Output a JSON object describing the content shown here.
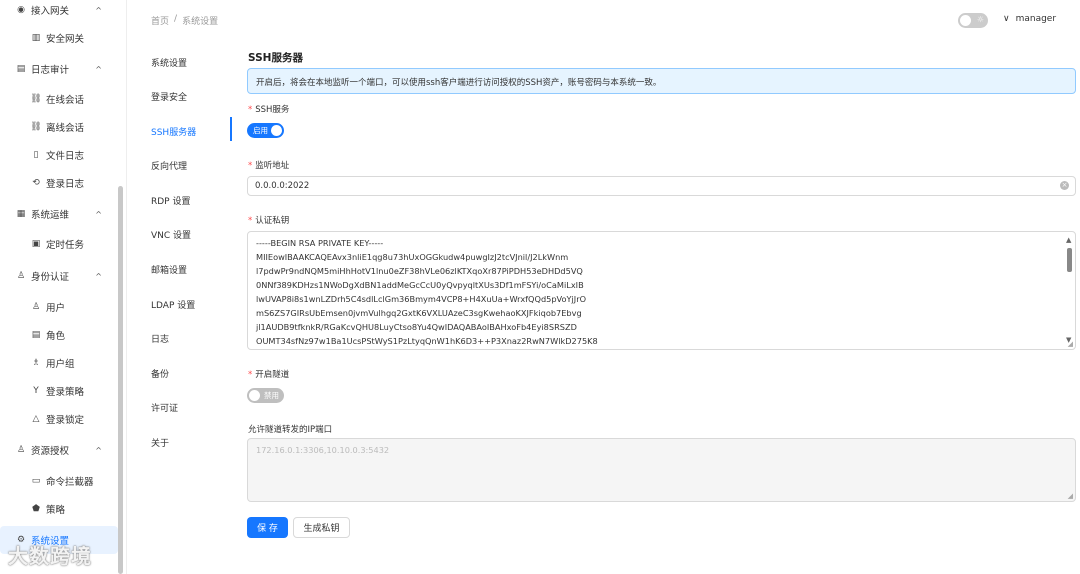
{
  "sidebar": {
    "items": [
      {
        "label": "接入网关",
        "icon": "eye-icon",
        "type": "group",
        "expanded": true
      },
      {
        "label": "安全网关",
        "icon": "gateway-icon",
        "type": "child"
      },
      {
        "label": "日志审计",
        "icon": "log-icon",
        "type": "group",
        "expanded": true
      },
      {
        "label": "在线会话",
        "icon": "link-icon",
        "type": "child"
      },
      {
        "label": "离线会话",
        "icon": "unlink-icon",
        "type": "child"
      },
      {
        "label": "文件日志",
        "icon": "file-icon",
        "type": "child"
      },
      {
        "label": "登录日志",
        "icon": "login-icon",
        "type": "child"
      },
      {
        "label": "系统运维",
        "icon": "grid-icon",
        "type": "group",
        "expanded": true
      },
      {
        "label": "定时任务",
        "icon": "task-icon",
        "type": "child"
      },
      {
        "label": "身份认证",
        "icon": "user-icon",
        "type": "group",
        "expanded": true
      },
      {
        "label": "用户",
        "icon": "user-icon",
        "type": "child"
      },
      {
        "label": "角色",
        "icon": "role-icon",
        "type": "child"
      },
      {
        "label": "用户组",
        "icon": "users-icon",
        "type": "child"
      },
      {
        "label": "登录策略",
        "icon": "strategy-icon",
        "type": "child"
      },
      {
        "label": "登录锁定",
        "icon": "warning-icon",
        "type": "child"
      },
      {
        "label": "资源授权",
        "icon": "user-icon",
        "type": "group",
        "expanded": true
      },
      {
        "label": "命令拦截器",
        "icon": "terminal-icon",
        "type": "child"
      },
      {
        "label": "策略",
        "icon": "shield-icon",
        "type": "child"
      },
      {
        "label": "系统设置",
        "icon": "settings-icon",
        "type": "group",
        "active": true
      }
    ]
  },
  "breadcrumb": {
    "home": "首页",
    "sep": "/",
    "current": "系统设置"
  },
  "header": {
    "user": "manager"
  },
  "settings_nav": {
    "items": [
      "系统设置",
      "登录安全",
      "SSH服务器",
      "反向代理",
      "RDP 设置",
      "VNC 设置",
      "邮箱设置",
      "LDAP 设置",
      "日志",
      "备份",
      "许可证",
      "关于"
    ],
    "active_index": 2
  },
  "form": {
    "title": "SSH服务器",
    "alert": "开启后，将会在本地监听一个端口，可以使用ssh客户端进行访问授权的SSH资产，账号密码与本系统一致。",
    "ssh_service": {
      "label": "SSH服务",
      "state_label": "启用",
      "enabled": true
    },
    "listen_addr": {
      "label": "监听地址",
      "value": "0.0.0.0:2022"
    },
    "private_key": {
      "label": "认证私钥",
      "lines": [
        "-----BEGIN RSA PRIVATE KEY-----",
        "MIIEowIBAAKCAQEAvx3nliE1qg8u73hUxOGGkudw4puwgIzJ2tcVJnil/J2LkWnm",
        "l7pdwPr9ndNQM5miHhHotV1lnu0eZF38hVLe06zlKTXqoXr87PiPDH53eDHDd5VQ",
        "0NNf389KDHzs1NWoDgXdBN1addMeGcCcU0yQvpyqltXUs3Df1mFSYi/oCaMiLxIB",
        "lwUVAP8i8s1wnLZDrh5C4sdlLclGm36Bmym4VCP8+H4XuUa+WrxfQQd5pVoYjJrO",
        "mS6ZS7GIRsUbEmsen0jvmVulhgq2GxtK6VXLUAzeC3sgKwehaoKXJFkiqob7Ebvg",
        "jl1AUDB9tfknkR/RGaKcvQHU8LuyCtso8Yu4QwIDAQABAoIBAHxoFb4Eyi8SRSZD",
        "OUMT34sfNz97w1Ba1UcsPStWyS1PzLtyqQnW1hK6D3++P3Xnaz2RwN7WlkD275K8"
      ]
    },
    "tunnel": {
      "label": "开启隧道",
      "state_label": "禁用",
      "enabled": false
    },
    "tunnel_ports": {
      "label": "允许隧道转发的IP端口",
      "placeholder": "172.16.0.1:3306,10.10.0.3:5432"
    },
    "save_label": "保 存",
    "gen_key_label": "生成私钥"
  },
  "watermark": "大数跨境"
}
